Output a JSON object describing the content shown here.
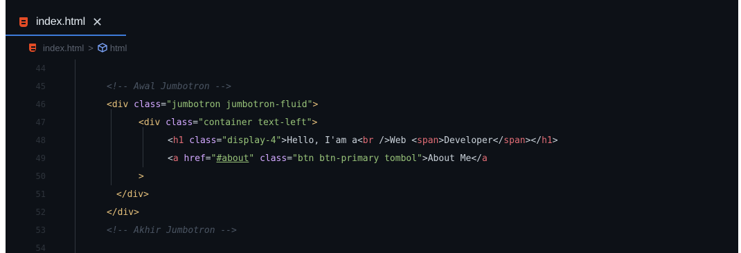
{
  "tab": {
    "label": "index.html",
    "close": "✕"
  },
  "breadcrumb": {
    "file": "index.html",
    "separator": ">",
    "symbol": "html"
  },
  "lines": [
    {
      "num": "44"
    },
    {
      "num": "45",
      "comment": "<!-- Awal Jumbotron -->"
    },
    {
      "num": "46",
      "open": "<",
      "tag": "div",
      "attr": "class",
      "eq": "=",
      "value": "\"jumbotron jumbotron-fluid\"",
      "close": ">"
    },
    {
      "num": "47",
      "open": "<",
      "tag": "div",
      "attr": "class",
      "eq": "=",
      "value": "\"container text-left\"",
      "close": ">"
    },
    {
      "num": "48",
      "p1": "<",
      "t1": "h1",
      "a1": " class",
      "e1": "=",
      "v1": "\"display-4\"",
      "p2": ">Hello, I'am a<",
      "t2": "br",
      "p3": " />Web <",
      "t3": "span",
      "p4": ">Developer</",
      "t4": "span",
      "p5": "></",
      "t5": "h1",
      "p6": ">"
    },
    {
      "num": "49",
      "p1": "<",
      "t1": "a",
      "a1": " href",
      "e1": "=",
      "v1a": "\"",
      "v1b": "#about",
      "v1c": "\"",
      "a2": " class",
      "e2": "=",
      "v2": "\"btn btn-primary tombol\"",
      "p2": ">About Me</",
      "t2": "a"
    },
    {
      "num": "50",
      "close": ">"
    },
    {
      "num": "51",
      "open": "</",
      "tag": "div",
      "close": ">"
    },
    {
      "num": "52",
      "open": "</",
      "tag": "div",
      "close": ">"
    },
    {
      "num": "53",
      "comment": "<!-- Akhir Jumbotron -->"
    },
    {
      "num": "54"
    }
  ],
  "colors": {
    "background": "#0d1117",
    "accent": "#3d7bd9",
    "tag": "#e5c07b",
    "attribute": "#d2a8ff",
    "string": "#98c379",
    "comment": "#4b5563"
  },
  "icons": {
    "tab_file": "html5-icon",
    "breadcrumb_file": "html5-icon",
    "breadcrumb_symbol": "cube-icon",
    "close": "close-icon"
  }
}
